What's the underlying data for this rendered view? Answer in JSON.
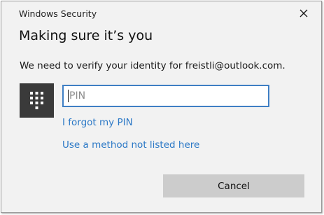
{
  "window": {
    "title": "Windows Security"
  },
  "dialog": {
    "heading": "Making sure it’s you",
    "message": "We need to verify your identity for freistli@outlook.com."
  },
  "pin": {
    "icon": "keypad-icon",
    "placeholder": "PIN",
    "value": ""
  },
  "links": {
    "forgot_pin": "I forgot my PIN",
    "other_method": "Use a method not listed here"
  },
  "buttons": {
    "cancel": "Cancel"
  },
  "colors": {
    "link": "#2b78c6",
    "input_border": "#3f7fc4",
    "keypad_tile": "#3a3a3a",
    "cancel_button": "#cccccc",
    "background": "#f2f2f2"
  }
}
